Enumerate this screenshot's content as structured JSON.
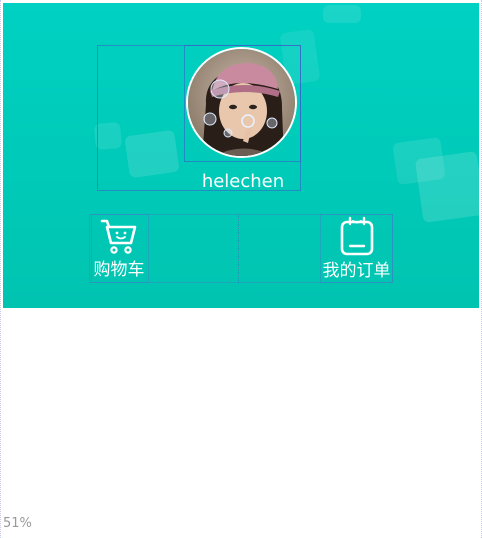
{
  "profile": {
    "username": "helechen",
    "avatar_icon": "user-avatar-photo"
  },
  "quick_actions": [
    {
      "label": "购物车",
      "icon": "shopping-cart-icon"
    },
    {
      "label": "我的订单",
      "icon": "order-clipboard-icon"
    }
  ],
  "status": {
    "zoom": "51%"
  },
  "colors": {
    "header_top": "#00d1c2",
    "header_bottom": "#00c4b0",
    "text_light": "#ffffff"
  }
}
